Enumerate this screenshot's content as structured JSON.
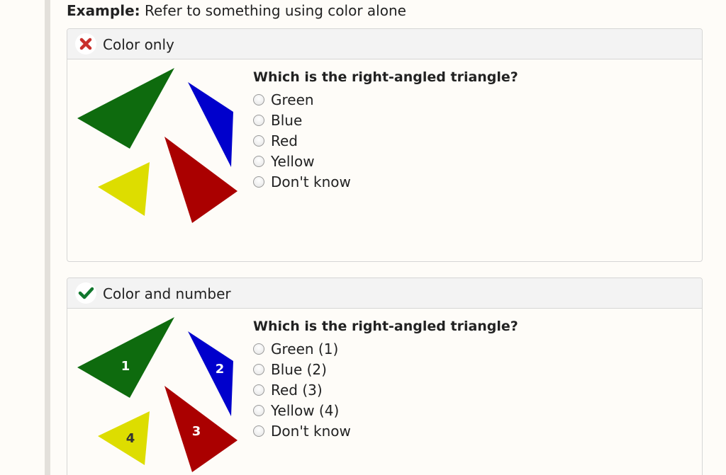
{
  "example": {
    "label": "Example:",
    "text": "Refer to something using color alone"
  },
  "colors": {
    "green": "#0e6b0e",
    "blue": "#0000cc",
    "red": "#aa0000",
    "yellow": "#dddd00",
    "bad_icon": "#c9302c",
    "good_icon": "#11772d"
  },
  "panels": [
    {
      "icon": "x-mark-icon",
      "title": "Color only",
      "question": "Which is the right-angled triangle?",
      "options": [
        "Green",
        "Blue",
        "Red",
        "Yellow",
        "Don't know"
      ],
      "triangle_numbers": []
    },
    {
      "icon": "checkmark-icon",
      "title": "Color and number",
      "question": "Which is the right-angled triangle?",
      "options": [
        "Green (1)",
        "Blue (2)",
        "Red (3)",
        "Yellow (4)",
        "Don't know"
      ],
      "triangle_numbers": [
        "1",
        "2",
        "3",
        "4"
      ]
    }
  ]
}
